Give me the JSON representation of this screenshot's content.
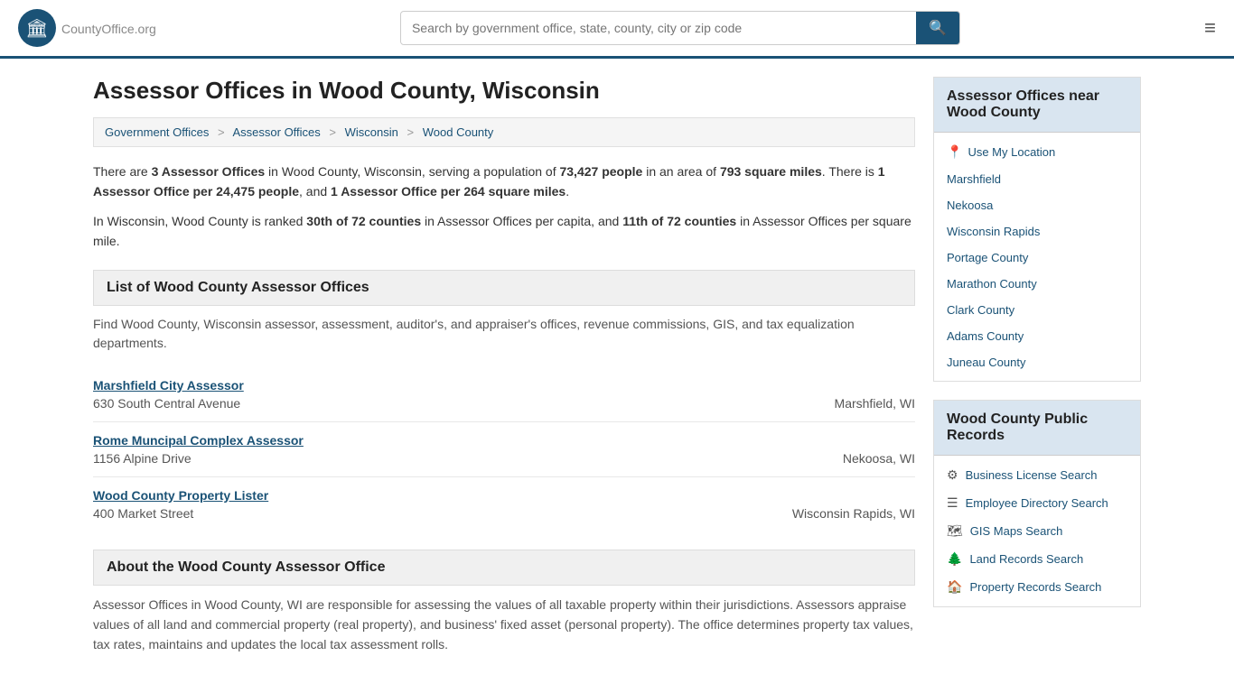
{
  "header": {
    "logo_text": "CountyOffice",
    "logo_suffix": ".org",
    "search_placeholder": "Search by government office, state, county, city or zip code",
    "search_btn_label": "🔍"
  },
  "page": {
    "title": "Assessor Offices in Wood County, Wisconsin",
    "breadcrumb": [
      {
        "label": "Government Offices",
        "href": "#"
      },
      {
        "label": "Assessor Offices",
        "href": "#"
      },
      {
        "label": "Wisconsin",
        "href": "#"
      },
      {
        "label": "Wood County",
        "href": "#"
      }
    ],
    "intro1": "There are ",
    "intro1b": "3 Assessor Offices",
    "intro1c": " in Wood County, Wisconsin, serving a population of ",
    "intro1d": "73,427 people",
    "intro1e": " in an area of ",
    "intro1f": "793 square miles",
    "intro1g": ". There is ",
    "intro1h": "1 Assessor Office per 24,475 people",
    "intro1i": ", and ",
    "intro1j": "1 Assessor Office per 264 square miles",
    "intro1k": ".",
    "intro2a": "In Wisconsin, Wood County is ranked ",
    "intro2b": "30th of 72 counties",
    "intro2c": " in Assessor Offices per capita, and ",
    "intro2d": "11th of 72 counties",
    "intro2e": " in Assessor Offices per square mile.",
    "list_section_title": "List of Wood County Assessor Offices",
    "list_section_desc": "Find Wood County, Wisconsin assessor, assessment, auditor's, and appraiser's offices, revenue commissions, GIS, and tax equalization departments.",
    "offices": [
      {
        "name": "Marshfield City Assessor",
        "address": "630 South Central Avenue",
        "city": "Marshfield, WI"
      },
      {
        "name": "Rome Muncipal Complex Assessor",
        "address": "1156 Alpine Drive",
        "city": "Nekoosa, WI"
      },
      {
        "name": "Wood County Property Lister",
        "address": "400 Market Street",
        "city": "Wisconsin Rapids, WI"
      }
    ],
    "about_title": "About the Wood County Assessor Office",
    "about_text": "Assessor Offices in Wood County, WI are responsible for assessing the values of all taxable property within their jurisdictions. Assessors appraise values of all land and commercial property (real property), and business' fixed asset (personal property). The office determines property tax values, tax rates, maintains and updates the local tax assessment rolls."
  },
  "sidebar": {
    "nearby_title": "Assessor Offices near Wood County",
    "use_location": "Use My Location",
    "nearby_links": [
      "Marshfield",
      "Nekoosa",
      "Wisconsin Rapids",
      "Portage County",
      "Marathon County",
      "Clark County",
      "Adams County",
      "Juneau County"
    ],
    "public_records_title": "Wood County Public Records",
    "public_records_links": [
      {
        "icon": "⚙",
        "label": "Business License Search"
      },
      {
        "icon": "☰",
        "label": "Employee Directory Search"
      },
      {
        "icon": "🗺",
        "label": "GIS Maps Search"
      },
      {
        "icon": "🌲",
        "label": "Land Records Search"
      },
      {
        "icon": "🏠",
        "label": "Property Records Search"
      }
    ]
  }
}
